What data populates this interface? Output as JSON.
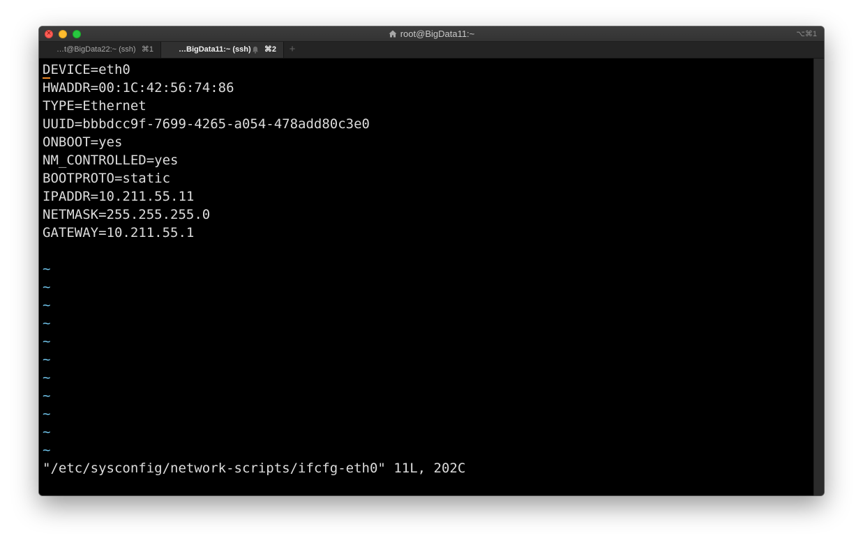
{
  "window": {
    "title": "root@BigData11:~",
    "title_icon": "house-icon",
    "window_shortcut": "⌥⌘1"
  },
  "tabs": [
    {
      "label": "…t@BigData22:~ (ssh)",
      "shortcut": "⌘1",
      "active": false
    },
    {
      "label": "…BigData11:~ (ssh)",
      "shortcut": "⌘2",
      "active": true,
      "icon": "bell-icon"
    }
  ],
  "new_tab_label": "+",
  "terminal": {
    "cursor_char": "D",
    "lines": [
      "EVICE=eth0",
      "HWADDR=00:1C:42:56:74:86",
      "TYPE=Ethernet",
      "UUID=bbbdcc9f-7699-4265-a054-478add80c3e0",
      "ONBOOT=yes",
      "NM_CONTROLLED=yes",
      "BOOTPROTO=static",
      "IPADDR=10.211.55.11",
      "NETMASK=255.255.255.0",
      "GATEWAY=10.211.55.1"
    ],
    "empty_marker": "~",
    "status_line": "\"/etc/sysconfig/network-scripts/ifcfg-eth0\" 11L, 202C"
  },
  "colors": {
    "text": "#dcdcdc",
    "tilde": "#6fc3ea",
    "cursor": "#f28c28",
    "background": "#000000"
  }
}
